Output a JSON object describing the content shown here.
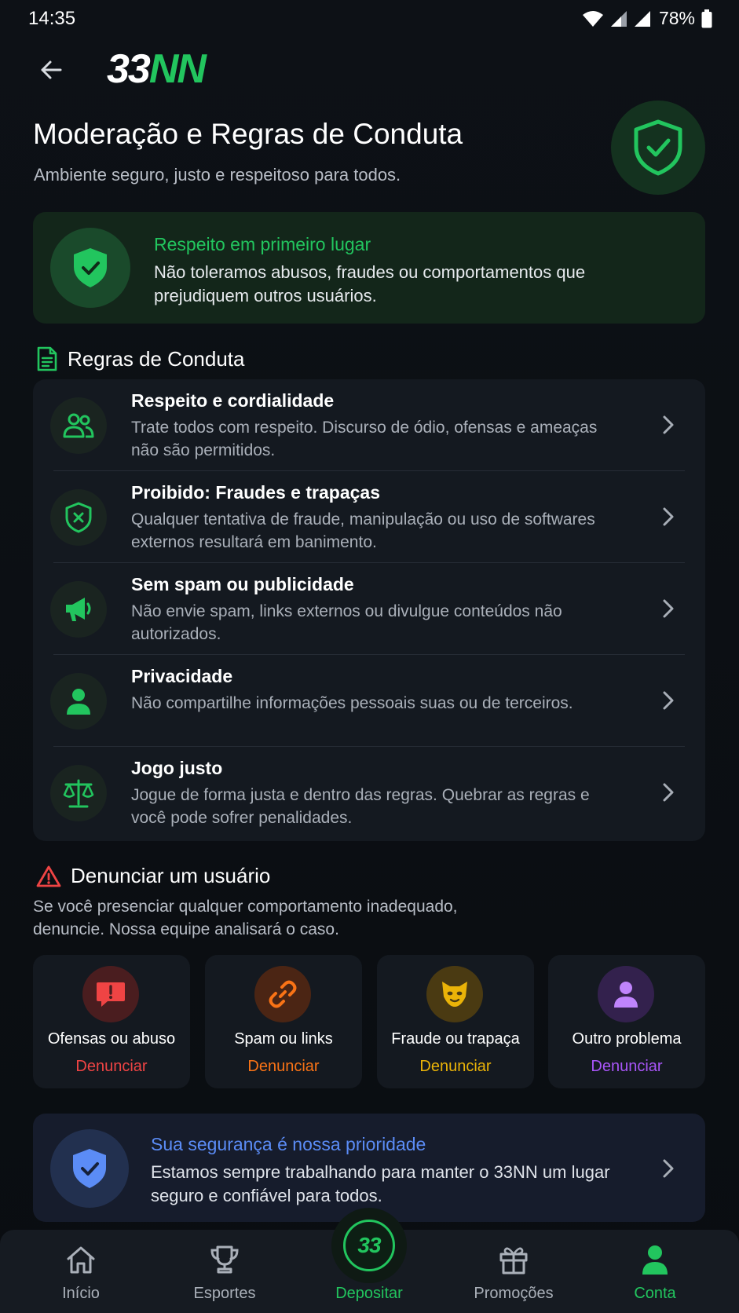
{
  "status_bar": {
    "time": "14:35",
    "battery": "78%"
  },
  "header": {
    "logo_part1": "33",
    "logo_part2": "NN"
  },
  "page": {
    "title": "Moderação e Regras de Conduta",
    "subtitle": "Ambiente seguro, justo e respeitoso para todos."
  },
  "respect_card": {
    "title": "Respeito em primeiro lugar",
    "text": "Não toleramos abusos, fraudes ou comportamentos que prejudiquem outros usuários."
  },
  "rules_section": {
    "heading": "Regras de Conduta",
    "items": [
      {
        "title": "Respeito e cordialidade",
        "desc": "Trate todos com respeito. Discurso de ódio, ofensas e ameaças não são permitidos.",
        "icon": "users-icon"
      },
      {
        "title": "Proibido: Fraudes e trapaças",
        "desc": "Qualquer tentativa de fraude, manipulação ou uso de softwares externos resultará em banimento.",
        "icon": "shield-x-icon"
      },
      {
        "title": "Sem spam ou publicidade",
        "desc": "Não envie spam, links externos ou divulgue conteúdos não autorizados.",
        "icon": "megaphone-icon"
      },
      {
        "title": "Privacidade",
        "desc": "Não compartilhe informações pessoais suas ou de terceiros.",
        "icon": "person-icon"
      },
      {
        "title": "Jogo justo",
        "desc": "Jogue de forma justa e dentro das regras. Quebrar as regras e você pode sofrer penalidades.",
        "icon": "scale-icon"
      }
    ]
  },
  "report_section": {
    "heading": "Denunciar um usuário",
    "intro": "Se você presenciar qualquer comportamento inadequado, denuncie. Nossa equipe analisará o caso.",
    "cards": [
      {
        "label": "Ofensas ou abuso",
        "action": "Denunciar",
        "color": "#ef4444",
        "icon": "alert-message-icon"
      },
      {
        "label": "Spam ou links",
        "action": "Denunciar",
        "color": "#f97316",
        "icon": "link-icon"
      },
      {
        "label": "Fraude ou trapaça",
        "action": "Denunciar",
        "color": "#eab308",
        "icon": "mask-icon"
      },
      {
        "label": "Outro problema",
        "action": "Denunciar",
        "color": "#a855f7",
        "icon": "user-icon"
      }
    ]
  },
  "safety_card": {
    "title": "Sua segurança é nossa prioridade",
    "text": "Estamos sempre trabalhando para manter o 33NN um lugar seguro e confiável para todos."
  },
  "bottom_nav": {
    "items": [
      {
        "label": "Início",
        "icon": "home-icon"
      },
      {
        "label": "Esportes",
        "icon": "trophy-icon"
      },
      {
        "label": "Depositar",
        "icon": "deposit-33-icon",
        "badge": "33"
      },
      {
        "label": "Promoções",
        "icon": "gift-icon"
      },
      {
        "label": "Conta",
        "icon": "account-icon"
      }
    ],
    "active": "Conta"
  },
  "colors": {
    "accent_green": "#22c55e",
    "accent_blue": "#5b8cf6",
    "background": "#0b0e12"
  }
}
